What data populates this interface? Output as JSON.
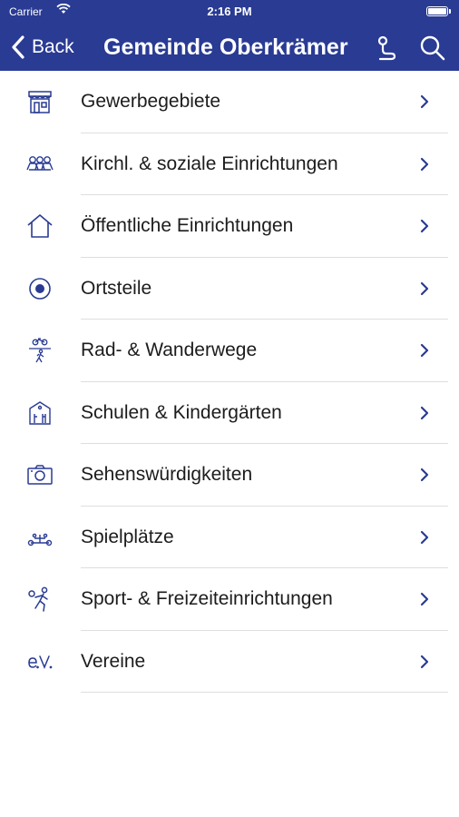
{
  "status_bar": {
    "carrier": "Carrier",
    "time": "2:16 PM"
  },
  "nav_bar": {
    "back_label": "Back",
    "title": "Gemeinde Oberkrämer",
    "route_icon": "route-icon",
    "search_icon": "search-icon"
  },
  "colors": {
    "header": "#293b93",
    "accent": "#293b93",
    "separator": "#dedede"
  },
  "categories": [
    {
      "label": "Gewerbegebiete",
      "icon": "shop-icon"
    },
    {
      "label": "Kirchl. & soziale Einrichtungen",
      "icon": "people-group-icon"
    },
    {
      "label": "Öffentliche Einrichtungen",
      "icon": "house-icon"
    },
    {
      "label": "Ortsteile",
      "icon": "target-dot-icon"
    },
    {
      "label": "Rad- & Wanderwege",
      "icon": "bike-hiker-icon"
    },
    {
      "label": "Schulen & Kindergärten",
      "icon": "school-icon"
    },
    {
      "label": "Sehenswürdigkeiten",
      "icon": "camera-icon"
    },
    {
      "label": "Spielplätze",
      "icon": "playground-icon"
    },
    {
      "label": "Sport- & Freizeiteinrichtungen",
      "icon": "sports-icon"
    },
    {
      "label": "Vereine",
      "icon": "ev-icon"
    }
  ]
}
